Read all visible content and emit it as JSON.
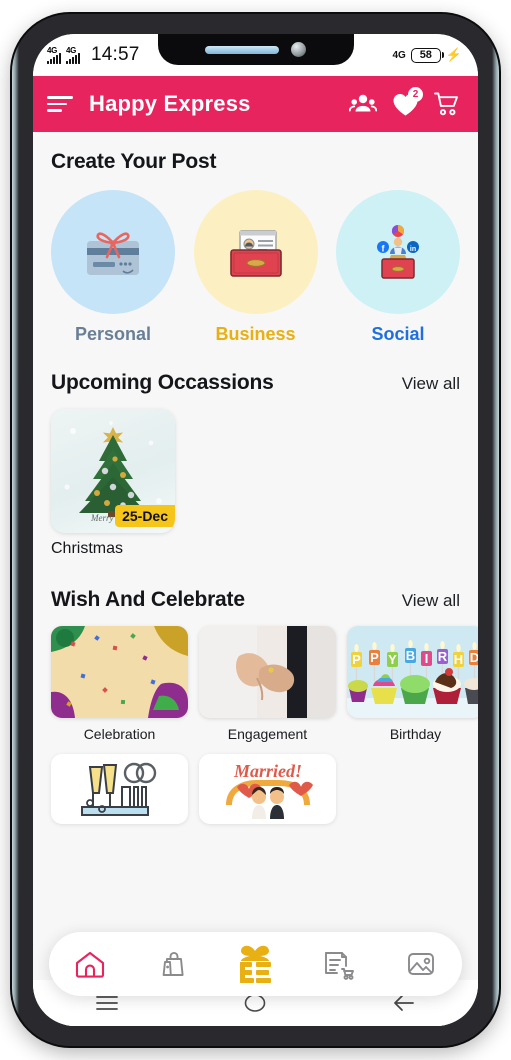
{
  "status_bar": {
    "network_left_1": "4G",
    "network_left_2": "4G",
    "time": "14:57",
    "network_right": "4G",
    "battery_level": "58",
    "charging_icon": "bolt-icon"
  },
  "header": {
    "menu_icon": "hamburger-menu-icon",
    "title": "Happy Express",
    "icons": [
      {
        "name": "group-people-icon",
        "badge": ""
      },
      {
        "name": "heart-favorites-icon",
        "badge": "2"
      },
      {
        "name": "shopping-cart-icon",
        "badge": ""
      }
    ],
    "brand_color": "#e8245f"
  },
  "create_post": {
    "title": "Create Your Post",
    "items": [
      {
        "label": "Personal",
        "label_color": "#6a7f96",
        "circle_color": "#c6e4f7",
        "icon": "gift-card-ribbon-icon"
      },
      {
        "label": "Business",
        "label_color": "#e8b012",
        "circle_color": "#fcf0c2",
        "icon": "briefcase-document-icon"
      },
      {
        "label": "Social",
        "label_color": "#1f6fe0",
        "circle_color": "#cdf1f5",
        "icon": "social-podium-icon"
      }
    ]
  },
  "occasions": {
    "title": "Upcoming Occassions",
    "view_all": "View all",
    "items": [
      {
        "name": "Christmas",
        "date_badge": "25-Dec",
        "thumb": "christmas-tree-thumbnail"
      }
    ]
  },
  "wish_celebrate": {
    "title": "Wish And Celebrate",
    "view_all": "View all",
    "row1": [
      {
        "name": "Celebration",
        "thumb": "confetti-card-thumbnail"
      },
      {
        "name": "Engagement",
        "thumb": "ring-exchange-photo-thumbnail"
      },
      {
        "name": "Birthday",
        "thumb": "birthday-cupcakes-thumbnail"
      }
    ],
    "row2": [
      {
        "name": "",
        "thumb": "champagne-rings-thumbnail"
      },
      {
        "name": "",
        "thumb": "married-couple-thumbnail"
      }
    ]
  },
  "bottom_nav": {
    "items": [
      {
        "name": "home-icon",
        "active": true,
        "color": "#e8245f"
      },
      {
        "name": "shopping-bag-icon",
        "active": false,
        "color": "#8b8b8e"
      },
      {
        "name": "he-gift-logo-icon",
        "active": false,
        "color": "#e8b012"
      },
      {
        "name": "orders-cart-icon",
        "active": false,
        "color": "#8b8b8e"
      },
      {
        "name": "gallery-image-icon",
        "active": false,
        "color": "#8b8b8e"
      }
    ]
  },
  "android_nav": {
    "recents": "recents-icon",
    "home": "home-circle-icon",
    "back": "back-arrow-icon"
  }
}
